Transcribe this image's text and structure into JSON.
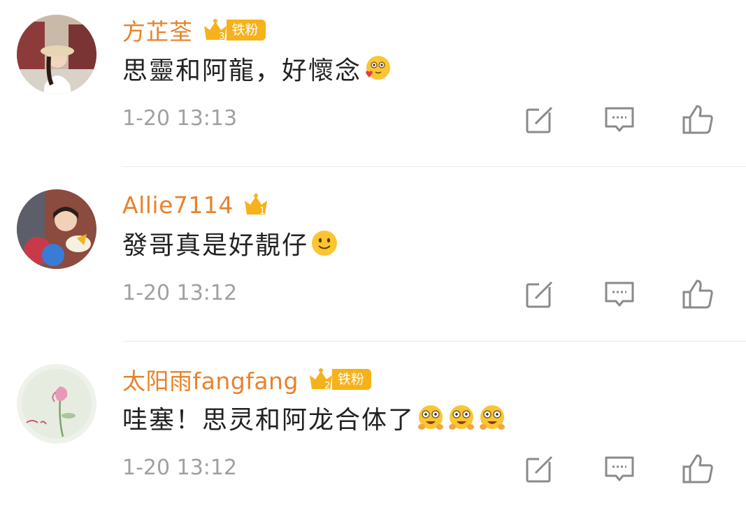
{
  "colors": {
    "username": "#e8822a",
    "fan_badge": "#f5b21b",
    "text": "#222222",
    "meta": "#a0a0a0",
    "divider": "#eaeaea",
    "icon": "#8a8a8a"
  },
  "comments": [
    {
      "username": "方芷荃",
      "badge": {
        "icon": "crown-icon",
        "level": "3",
        "label": "铁粉"
      },
      "text": "思靈和阿龍，好懷念",
      "emojis": [
        "shy-heart-emoji"
      ],
      "time": "1-20 13:13",
      "actions": [
        "repost-icon",
        "comment-icon",
        "like-icon"
      ]
    },
    {
      "username": "Allie7114",
      "badge": {
        "icon": "crown-icon",
        "level": "1",
        "label": ""
      },
      "text": "發哥真是好靚仔",
      "emojis": [
        "smile-emoji"
      ],
      "time": "1-20 13:12",
      "actions": [
        "repost-icon",
        "comment-icon",
        "like-icon"
      ]
    },
    {
      "username": "太阳雨fangfang",
      "badge": {
        "icon": "crown-icon",
        "level": "2",
        "label": "铁粉"
      },
      "text": "哇塞！思灵和阿龙合体了",
      "emojis": [
        "excited-emoji",
        "excited-emoji",
        "excited-emoji"
      ],
      "time": "1-20 13:12",
      "actions": [
        "repost-icon",
        "comment-icon",
        "like-icon"
      ]
    }
  ]
}
